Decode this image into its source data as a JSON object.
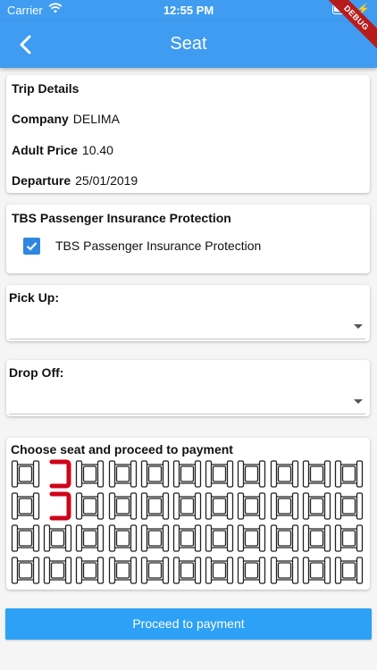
{
  "status_bar": {
    "carrier": "Carrier",
    "time": "12:55 PM",
    "wifi_icon": "wifi-icon",
    "battery_icon": "battery-icon"
  },
  "app_bar": {
    "title": "Seat",
    "back_icon": "back-arrow-icon",
    "color": "#3f9cf0"
  },
  "debug_banner": "DEBUG",
  "trip_details": {
    "title": "Trip Details",
    "company_label": "Company",
    "company_value": "DELIMA",
    "price_label": "Adult Price",
    "price_value": "10.40",
    "departure_label": "Departure",
    "departure_value": "25/01/2019"
  },
  "insurance": {
    "title": "TBS Passenger Insurance Protection",
    "checkbox_label": "TBS Passenger Insurance Protection",
    "checked": true
  },
  "pick_up": {
    "label": "Pick Up:",
    "value": ""
  },
  "drop_off": {
    "label": "Drop Off:",
    "value": ""
  },
  "seats": {
    "title": "Choose seat and proceed to payment",
    "rows": 4,
    "cols": 11,
    "selected": [
      [
        0,
        1
      ],
      [
        1,
        1
      ]
    ],
    "selected_color": "#d0021b",
    "default_color": "#222222"
  },
  "proceed_button": {
    "label": "Proceed to payment",
    "color": "#2da1f5"
  }
}
